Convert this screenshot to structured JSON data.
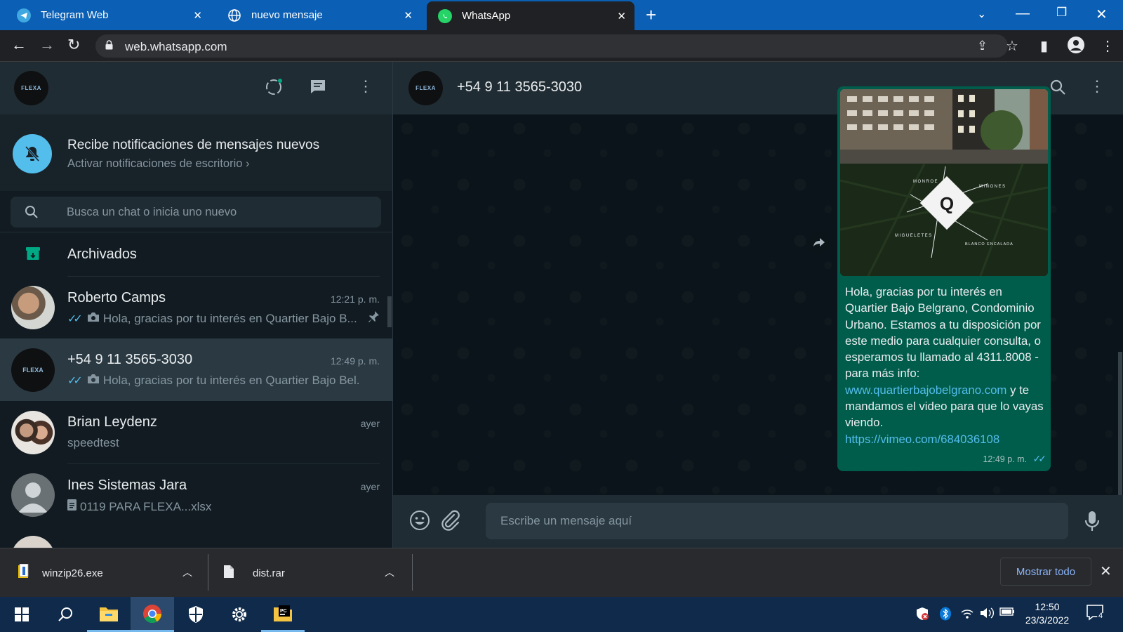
{
  "browser": {
    "tabs": [
      {
        "title": "Telegram Web",
        "icon": "telegram-icon"
      },
      {
        "title": "nuevo mensaje",
        "icon": "globe-icon"
      },
      {
        "title": "WhatsApp",
        "icon": "whatsapp-icon"
      }
    ],
    "url": "web.whatsapp.com"
  },
  "profile_logo_text": "FLEXA",
  "notification": {
    "title": "Recibe notificaciones de mensajes nuevos",
    "subtitle": "Activar notificaciones de escritorio ›"
  },
  "search": {
    "placeholder": "Busca un chat o inicia uno nuevo"
  },
  "archived_label": "Archivados",
  "chats": [
    {
      "name": "Roberto Camps",
      "time": "12:21 p. m.",
      "preview": "Hola, gracias por tu interés en Quartier Bajo B...",
      "pinned": true
    },
    {
      "name": "+54 9 11 3565-3030",
      "time": "12:49 p. m.",
      "preview": "Hola, gracias por tu interés en Quartier Bajo Bel..."
    },
    {
      "name": "Brian Leydenz",
      "time": "ayer",
      "preview": "speedtest"
    },
    {
      "name": "Ines Sistemas Jara",
      "time": "ayer",
      "preview": "0119 PARA FLEXA...xlsx"
    }
  ],
  "conversation": {
    "contact": "+54 9 11 3565-3030",
    "message": {
      "text_part1": "Hola, gracias por tu interés en Quartier Bajo Belgrano, Condominio Urbano. Estamos a tu disposición por este medio para cualquier consulta, o esperamos tu llamado al 4311.8008  - para más info: ",
      "link1": "www.quartierbajobelgrano.com",
      "text_part2": " y te mandamos el video para que lo vayas viendo.",
      "link2": "https://vimeo.com/684036108",
      "time": "12:49 p. m.",
      "image_labels": {
        "top_left": "MONROE",
        "top_right": "MIÑONES",
        "bottom_left": "MIGUELETES",
        "bottom_right": "BLANCO ENCALADA"
      }
    }
  },
  "composer": {
    "placeholder": "Escribe un mensaje aquí"
  },
  "downloads": {
    "items": [
      {
        "name": "winzip26.exe"
      },
      {
        "name": "dist.rar"
      }
    ],
    "show_all": "Mostrar todo"
  },
  "taskbar": {
    "time": "12:50",
    "date": "23/3/2022",
    "notification_count": "4"
  },
  "colors": {
    "accent": "#00a884",
    "bubble_out": "#005c4b",
    "link": "#53bdeb",
    "tabstrip": "#0b5fb4"
  }
}
